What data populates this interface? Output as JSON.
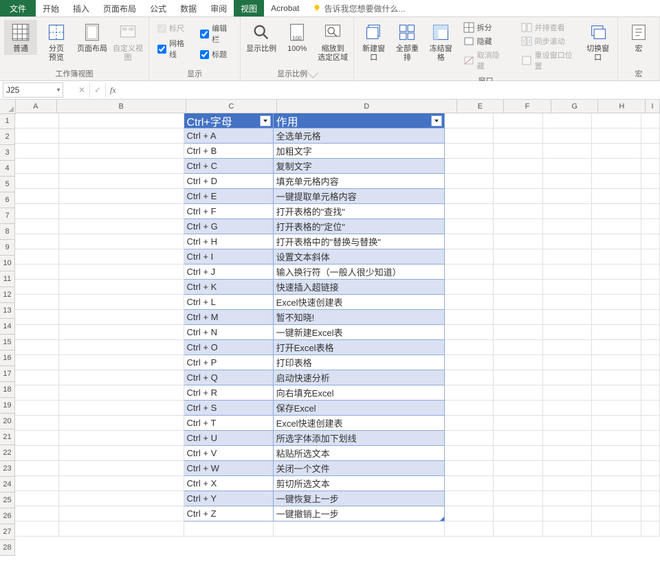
{
  "tabs": {
    "file": "文件",
    "items": [
      "开始",
      "插入",
      "页面布局",
      "公式",
      "数据",
      "审阅",
      "视图",
      "Acrobat"
    ],
    "active": "视图",
    "tellme": "告诉我您想要做什么..."
  },
  "ribbon": {
    "views": {
      "normal": "普通",
      "pagebreak": "分页\n预览",
      "pagelayout": "页面布局",
      "custom": "自定义视图",
      "group": "工作簿视图"
    },
    "show": {
      "ruler": "标尺",
      "formulabar": "编辑栏",
      "gridlines": "网格线",
      "headings": "标题",
      "group": "显示"
    },
    "zoom": {
      "zoom": "显示比例",
      "hundred": "100%",
      "selection": "缩放到\n选定区域",
      "group": "显示比例"
    },
    "window": {
      "new": "新建窗口",
      "arrange": "全部重排",
      "freeze": "冻结窗格",
      "split": "拆分",
      "hide": "隐藏",
      "unhide": "取消隐藏",
      "sidebyside": "并排查看",
      "syncscroll": "同步滚动",
      "resetpos": "重设窗口位置",
      "switch": "切换窗口",
      "group": "窗口"
    },
    "macros": {
      "macros": "宏",
      "group": "宏"
    }
  },
  "namebox": "J25",
  "formula": "",
  "columns": [
    "A",
    "B",
    "C",
    "D",
    "E",
    "F",
    "G",
    "H",
    "I"
  ],
  "row_start": 1,
  "row_end": 28,
  "table": {
    "headers": [
      "Ctrl+字母",
      "作用"
    ],
    "rows": [
      [
        "Ctrl + A",
        "全选单元格"
      ],
      [
        "Ctrl + B",
        "加粗文字"
      ],
      [
        "Ctrl + C",
        "复制文字"
      ],
      [
        "Ctrl + D",
        "填充单元格内容"
      ],
      [
        "Ctrl + E",
        "一键提取单元格内容"
      ],
      [
        "Ctrl + F",
        "打开表格的\"查找\""
      ],
      [
        "Ctrl + G",
        "打开表格的\"定位\""
      ],
      [
        "Ctrl + H",
        "打开表格中的\"替换与替换\""
      ],
      [
        "Ctrl + I",
        "设置文本斜体"
      ],
      [
        "Ctrl + J",
        "输入换行符（一般人很少知道）"
      ],
      [
        "Ctrl + K",
        "快速插入超链接"
      ],
      [
        "Ctrl + L",
        " Excel快速创建表"
      ],
      [
        "Ctrl + M",
        " 暂不知晓!"
      ],
      [
        "Ctrl + N",
        "一键新建Excel表"
      ],
      [
        "Ctrl + O",
        "打开Excel表格"
      ],
      [
        "Ctrl + P",
        "打印表格"
      ],
      [
        "Ctrl + Q",
        "启动快速分析"
      ],
      [
        "Ctrl + R",
        "向右填充Excel"
      ],
      [
        "Ctrl + S",
        "保存Excel"
      ],
      [
        "Ctrl + T",
        "Excel快速创建表"
      ],
      [
        "Ctrl + U",
        " 所选字体添加下划线"
      ],
      [
        "Ctrl + V",
        "粘贴所选文本"
      ],
      [
        "Ctrl + W",
        "关闭一个文件"
      ],
      [
        "Ctrl + X",
        "剪切所选文本"
      ],
      [
        "Ctrl + Y",
        "一键恢复上一步"
      ],
      [
        "Ctrl + Z",
        "一键撤销上一步"
      ]
    ]
  }
}
